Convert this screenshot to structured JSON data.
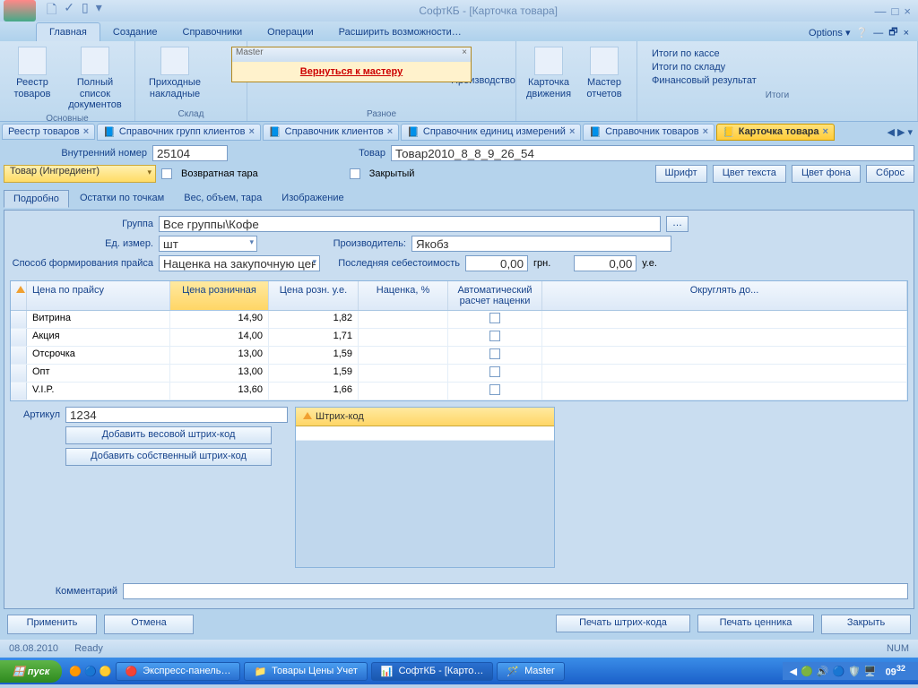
{
  "app": {
    "title": "СофтКБ - [Карточка товара]",
    "options": "Options"
  },
  "ribbon_tabs": [
    "Главная",
    "Создание",
    "Справочники",
    "Операции",
    "Расширить возможности…"
  ],
  "ribbon": {
    "group1_label": "Основные",
    "group2_label": "Склад",
    "group3_label": "Разное",
    "group4_label": "Итоги",
    "btn_registry": "Реестр товаров",
    "btn_fulllist": "Полный список документов",
    "btn_incoming": "Приходные накладные",
    "btn_prod": "Производство",
    "btn_move": "Карточка движения",
    "btn_report": "Мастер отчетов",
    "link_kassa": "Итоги по кассе",
    "link_sklad": "Итоги по складу",
    "link_fin": "Финансовый результат"
  },
  "master": {
    "title": "Master",
    "link": "Вернуться к мастеру"
  },
  "doctabs": {
    "t1": "Реестр товаров",
    "t2": "Справочник групп клиентов",
    "t3": "Справочник клиентов",
    "t4": "Справочник единиц измерений",
    "t5": "Справочник товаров",
    "t6": "Карточка товара"
  },
  "form": {
    "inner_no_label": "Внутренний номер",
    "inner_no": "25104",
    "product_label": "Товар",
    "product": "Товар2010_8_8_9_26_54",
    "type_dropdown": "Товар (Ингредиент)",
    "return_tara": "Возвратная тара",
    "closed": "Закрытый",
    "font_btn": "Шрифт",
    "textcolor_btn": "Цвет текста",
    "bgcolor_btn": "Цвет фона",
    "reset_btn": "Сброс"
  },
  "subtabs": [
    "Подробно",
    "Остатки по точкам",
    "Вес, объем, тара",
    "Изображение"
  ],
  "details": {
    "group_label": "Группа",
    "group": "Все группы\\Кофе",
    "unit_label": "Ед. измер.",
    "unit": "шт",
    "producer_label": "Производитель:",
    "producer": "Якобз",
    "price_method_label": "Способ формирования прайса",
    "price_method": "Наценка на закупочную цену",
    "last_cost_label": "Последняя себестоимость",
    "last_cost_grn": "0,00",
    "grn": "грн.",
    "last_cost_ue": "0,00",
    "ue": "у.е."
  },
  "price_grid": {
    "headers": [
      "Цена по прайсу",
      "Цена розничная",
      "Цена розн. у.е.",
      "Наценка, %",
      "Автоматический расчет наценки",
      "Округлять до..."
    ],
    "rows": [
      {
        "name": "Витрина",
        "retail": "14,90",
        "ue": "1,82",
        "markup": "",
        "auto": false
      },
      {
        "name": "Акция",
        "retail": "14,00",
        "ue": "1,71",
        "markup": "",
        "auto": false
      },
      {
        "name": "Отсрочка",
        "retail": "13,00",
        "ue": "1,59",
        "markup": "",
        "auto": false
      },
      {
        "name": "Опт",
        "retail": "13,00",
        "ue": "1,59",
        "markup": "",
        "auto": false
      },
      {
        "name": "V.I.P.",
        "retail": "13,60",
        "ue": "1,66",
        "markup": "",
        "auto": false
      }
    ]
  },
  "article": {
    "label": "Артикул",
    "value": "1234",
    "add_weight": "Добавить весовой штрих-код",
    "add_own": "Добавить собственный штрих-код"
  },
  "barcode": {
    "header": "Штрих-код"
  },
  "comment_label": "Комментарий",
  "buttons": {
    "apply": "Применить",
    "cancel": "Отмена",
    "print_barcode": "Печать штрих-кода",
    "print_tag": "Печать ценника",
    "close": "Закрыть"
  },
  "status": {
    "date": "08.08.2010",
    "ready": "Ready",
    "num": "NUM"
  },
  "taskbar": {
    "start": "пуск",
    "t1": "Экспресс-панель…",
    "t2": "Товары Цены Учет",
    "t3": "СофтКБ - [Карто…",
    "t4": "Master",
    "clock": "09",
    "clock_min": "32"
  }
}
